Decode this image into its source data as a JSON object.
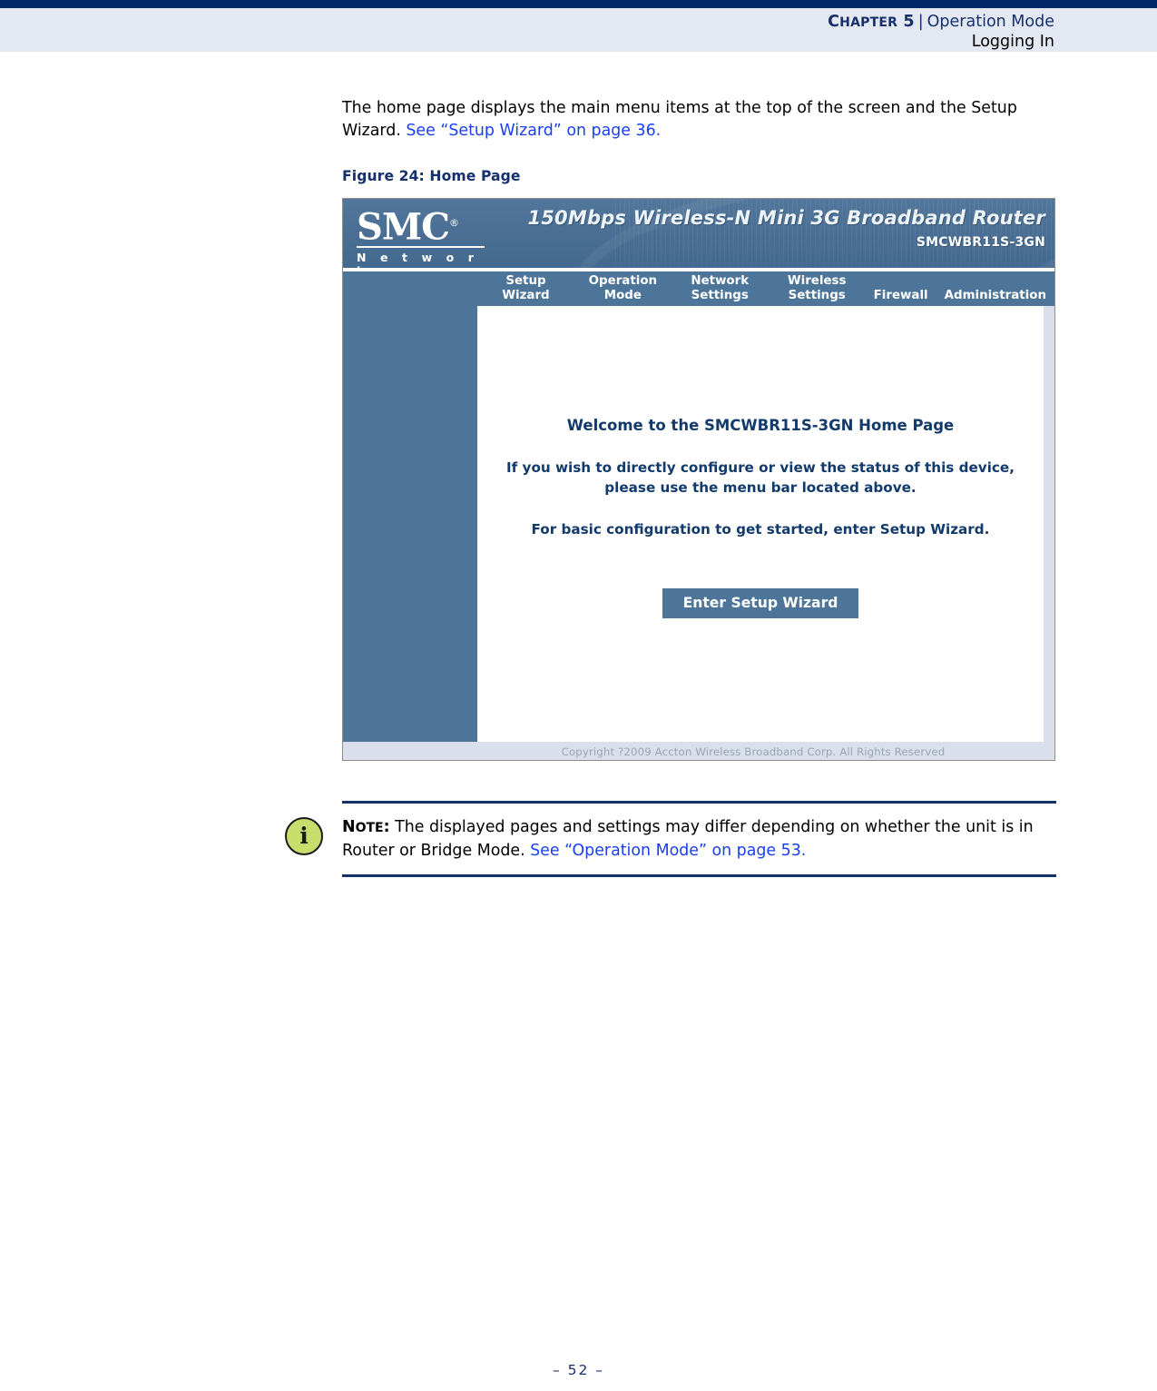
{
  "header": {
    "chapter_label": "CHAPTER 5",
    "chapter_label_lead": "C",
    "chapter_label_rest": "HAPTER",
    "chapter_number": "5",
    "separator": "|",
    "chapter_title": "Operation Mode",
    "section_title": "Logging In"
  },
  "body": {
    "paragraph_part1": "The home page displays the main menu items at the top of the screen and the Setup Wizard. ",
    "paragraph_xref": "See “Setup Wizard” on page 36.",
    "figure_caption": "Figure 24:  Home Page"
  },
  "router_ui": {
    "logo": {
      "brand": "SMC",
      "registered": "®",
      "tagline": "N e t w o r k s"
    },
    "banner": {
      "product_title": "150Mbps Wireless-N Mini 3G Broadband Router",
      "model": "SMCWBR11S-3GN"
    },
    "nav": [
      {
        "label_line1": "Setup",
        "label_line2": "Wizard",
        "lines": 2
      },
      {
        "label_line1": "Operation",
        "label_line2": "Mode",
        "lines": 2
      },
      {
        "label_line1": "Network",
        "label_line2": "Settings",
        "lines": 2
      },
      {
        "label_line1": "Wireless",
        "label_line2": "Settings",
        "lines": 2
      },
      {
        "label_line1": "Firewall",
        "label_line2": "",
        "lines": 1
      },
      {
        "label_line1": "Administration",
        "label_line2": "",
        "lines": 1
      }
    ],
    "content": {
      "welcome_title": "Welcome to the SMCWBR11S-3GN Home Page",
      "paragraph_1_line1": "If you wish to directly configure or view the status of this device,",
      "paragraph_1_line2": "please use the menu bar located above.",
      "paragraph_2": "For basic configuration to get started, enter Setup Wizard.",
      "button_label": "Enter Setup Wizard"
    },
    "footer_copyright": "Copyright ?2009 Accton Wireless Broadband Corp. All Rights Reserved",
    "colors": {
      "banner_blue": "#4d7499",
      "sidebar_blue": "#4d7499",
      "panel_lavender": "#d9e0ec",
      "heading_navy": "#123a6b"
    }
  },
  "note": {
    "label_lead": "N",
    "label_rest": "OTE",
    "label_colon": ":",
    "text_part1": " The displayed pages and settings may differ depending on whether the unit is in Router or Bridge Mode. ",
    "text_xref": "See “Operation Mode” on page 53.",
    "icon_glyph": "i"
  },
  "footer": {
    "page_number": "–  52  –"
  },
  "theme": {
    "navy": "#15306b",
    "top_rule": "#002868",
    "header_band": "#e4e8f2",
    "link_blue": "#1a3ff0",
    "note_icon_green": "#c9dd6c"
  }
}
